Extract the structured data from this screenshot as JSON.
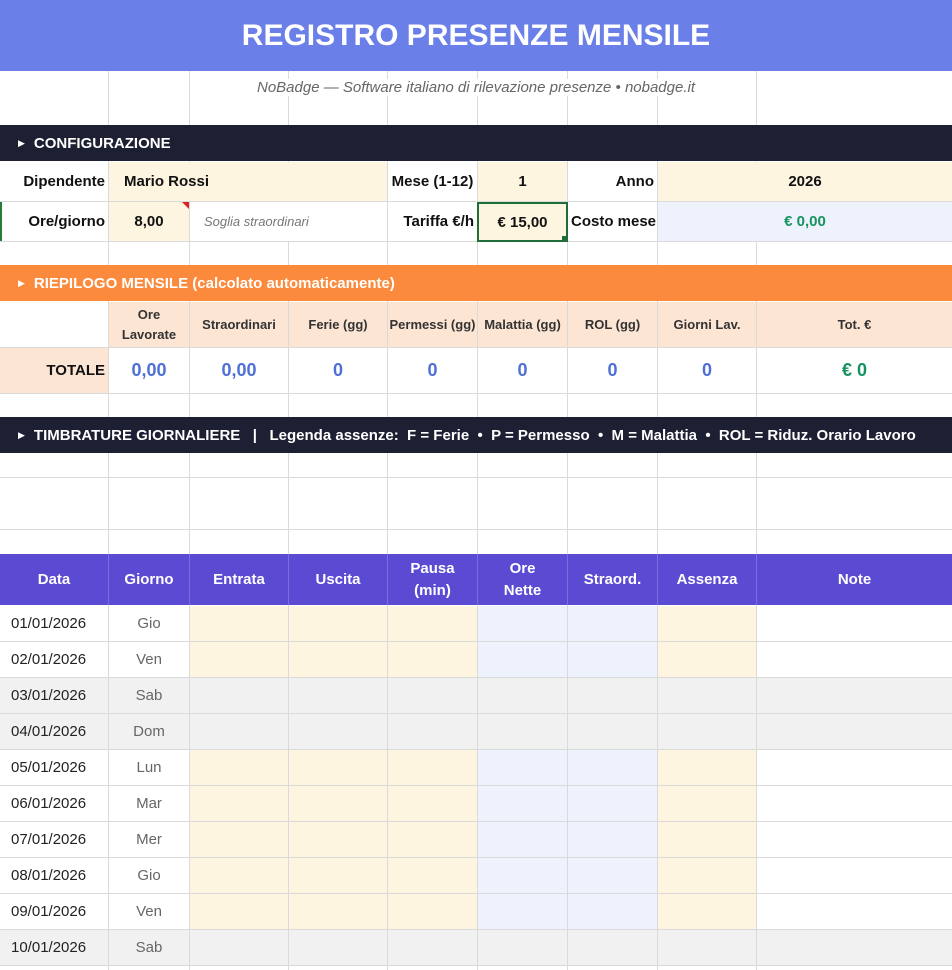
{
  "title": "REGISTRO PRESENZE MENSILE",
  "subtitle": "NoBadge — Software italiano di rilevazione presenze • nobadge.it",
  "config": {
    "section_title": "CONFIGURAZIONE",
    "dipendente_label": "Dipendente",
    "dipendente_value": "Mario Rossi",
    "mese_label": "Mese (1-12)",
    "mese_value": "1",
    "anno_label": "Anno",
    "anno_value": "2026",
    "ore_label": "Ore/giorno",
    "ore_value": "8,00",
    "soglia_label": "Soglia straordinari",
    "tariffa_label": "Tariffa €/h",
    "tariffa_value": "€ 15,00",
    "costo_label": "Costo mese",
    "costo_value": "€ 0,00"
  },
  "summary": {
    "section_title": "RIEPILOGO MENSILE (calcolato automaticamente)",
    "headers": [
      "Ore\nLavorate",
      "Straordinari",
      "Ferie (gg)",
      "Permessi (gg)",
      "Malattia (gg)",
      "ROL (gg)",
      "Giorni Lav.",
      "Tot. €"
    ],
    "total_label": "TOTALE",
    "values": [
      "0,00",
      "0,00",
      "0",
      "0",
      "0",
      "0",
      "0",
      "€ 0"
    ]
  },
  "timbrature": {
    "section_title": "TIMBRATURE GIORNALIERE   |   Legenda assenze:  F = Ferie  •  P = Permesso  •  M = Malattia  •  ROL = Riduz. Orario Lavoro",
    "headers": [
      "Data",
      "Giorno",
      "Entrata",
      "Uscita",
      "Pausa\n(min)",
      "Ore\nNette",
      "Straord.",
      "Assenza",
      "Note"
    ],
    "rows": [
      {
        "date": "01/01/2026",
        "day": "Gio",
        "weekend": false
      },
      {
        "date": "02/01/2026",
        "day": "Ven",
        "weekend": false
      },
      {
        "date": "03/01/2026",
        "day": "Sab",
        "weekend": true
      },
      {
        "date": "04/01/2026",
        "day": "Dom",
        "weekend": true
      },
      {
        "date": "05/01/2026",
        "day": "Lun",
        "weekend": false
      },
      {
        "date": "06/01/2026",
        "day": "Mar",
        "weekend": false
      },
      {
        "date": "07/01/2026",
        "day": "Mer",
        "weekend": false
      },
      {
        "date": "08/01/2026",
        "day": "Gio",
        "weekend": false
      },
      {
        "date": "09/01/2026",
        "day": "Ven",
        "weekend": false
      },
      {
        "date": "10/01/2026",
        "day": "Sab",
        "weekend": true
      }
    ]
  },
  "colors": {
    "banner": "#6b7fe8",
    "dark_section": "#1d1f33",
    "orange_section": "#fb8a3c",
    "table_header": "#5b4bd3",
    "input_cell": "#fdf5e0",
    "calc_cell": "#eef2fd",
    "weekend_row": "#f1f1f1",
    "summary_header": "#fde5d4",
    "accent_blue": "#4f6fd6",
    "accent_green": "#16935e"
  }
}
